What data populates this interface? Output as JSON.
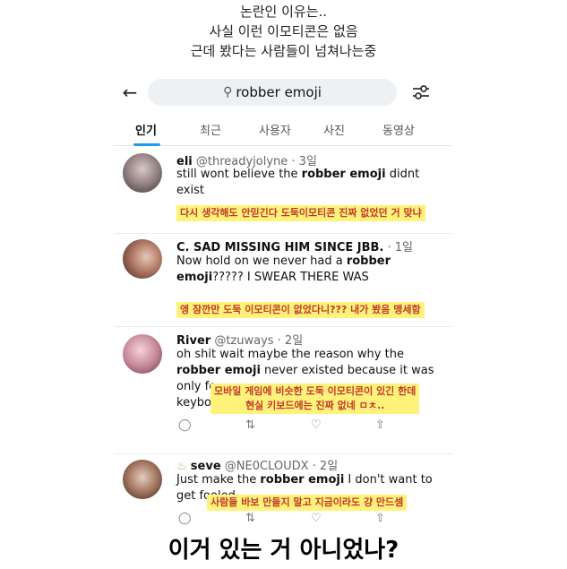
{
  "captions": {
    "line1": "논란인 이유는..",
    "line2": "사실 이런 이모티콘은 없음",
    "line3": "근데 봤다는 사람들이 넘쳐나는중",
    "bottom": "이거 있는 거 아니었나?"
  },
  "search": {
    "query": "robber emoji",
    "back_icon": "arrow-left-icon",
    "filter_icon": "sliders-icon"
  },
  "tabs": [
    "인기",
    "최근",
    "사용자",
    "사진",
    "동영상"
  ],
  "active_tab": "인기",
  "colors": {
    "tab_underline": "#1d9bf0",
    "highlight_bg": "#fff27a",
    "highlight_text": "#c0392b"
  },
  "posts": [
    {
      "name": "eli",
      "handle": "@threadyjolyne · 3일",
      "text_pre": "still wont believe the ",
      "text_bold": "robber emoji",
      "text_post": " didnt exist",
      "annotation": "다시 생각해도 안믿긴다 도둑이모티콘 진짜 없었던 거 맞냐"
    },
    {
      "name": "C. SAD MISSING HIM SINCE JBB.",
      "handle": "· 1일",
      "text_pre": "Now hold on we never had a ",
      "text_bold": "robber emoji",
      "text_post": "????? I SWEAR THERE WAS",
      "annotation": "엥 잠깐만 도둑 이모티콘이 없었다니??? 내가 봤음 맹세함"
    },
    {
      "name": "River",
      "handle": "@tzuways · 2일",
      "text_pre": "oh shit wait maybe the reason why the ",
      "text_bold": "robber emoji",
      "text_post": " never existed because it was",
      "text_cut1": "only fo",
      "text_cut2": "keybo",
      "annotation_line1": "모바일 게임에 비슷한 도둑 이모티콘이 있긴 한데",
      "annotation_line2": "현실 키보드에는 진짜 없네 ㅁㅊ.."
    },
    {
      "name": "seve",
      "handle": "@NE0CLOUDX · 2일",
      "text_pre": "Just make the ",
      "text_bold": "robber emoji",
      "text_post": " I don't want to",
      "text_line2": "get fooled",
      "annotation": "사람들 바보 만들지 말고 지금이라도 걍 만드셈"
    }
  ]
}
